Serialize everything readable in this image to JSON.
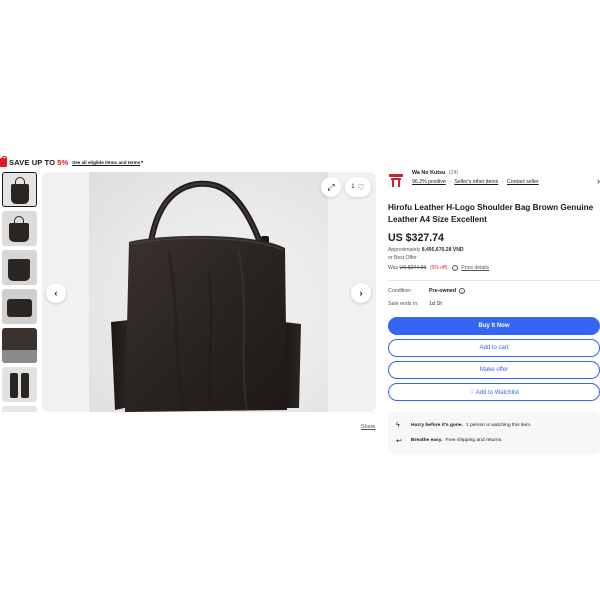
{
  "promo": {
    "save_text": "SAVE UP TO",
    "percent": "5%",
    "link_text": "See all eligible items and terms",
    "arrow": "▸",
    "accent": "#e0182d"
  },
  "gallery": {
    "thumbnail_count": 7,
    "selected_index": 0,
    "prev_icon": "chevron-left-icon",
    "next_icon": "chevron-right-icon",
    "watch_count": "1",
    "share_label": "Share"
  },
  "seller": {
    "name": "Wa No Kutsu",
    "feedback_count": "(24)",
    "positive": "96.2% positive",
    "other_items": "Seller's other items",
    "contact": "Contact seller"
  },
  "listing": {
    "title_line1": "Hirofu Leather H-Logo Shoulder Bag Brown Genuine",
    "title_line2": "Leather A4 Size Excellent",
    "price": "US $327.74",
    "approx_label": "Approximately",
    "approx_value": "8,495,676.28 VND",
    "best_offer": "or Best Offer",
    "was_label": "Was",
    "was_price": "US $344.99",
    "discount": "(5% off)",
    "price_details": "Price details"
  },
  "details": {
    "condition_label": "Condition:",
    "condition_value": "Pre-owned",
    "ends_label": "Sale ends in:",
    "ends_value": "1d 1h"
  },
  "actions": {
    "buy_now": "Buy It Now",
    "add_to_cart": "Add to cart",
    "make_offer": "Make offer",
    "watchlist": "♡ Add to Watchlist",
    "accent": "#3665f3"
  },
  "callouts": [
    {
      "icon": "lightning-icon",
      "bold": "Hurry before it's gone.",
      "text": "1 person is watching this item."
    },
    {
      "icon": "return-arrow-icon",
      "bold": "Breathe easy.",
      "text": "Free shipping and returns."
    }
  ]
}
